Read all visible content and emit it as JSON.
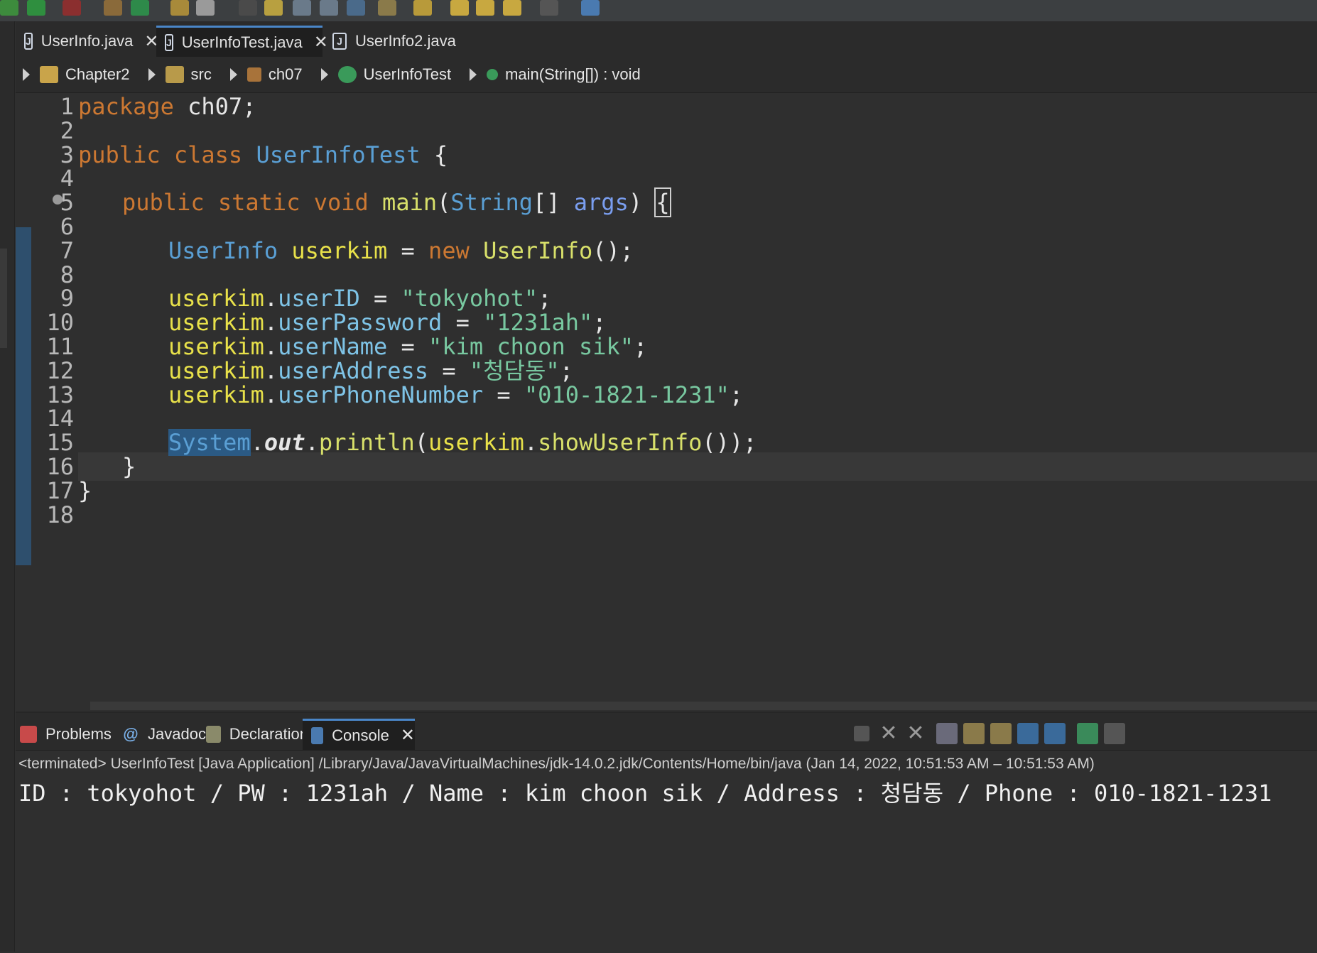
{
  "editor_tabs": [
    {
      "label": "UserInfo.java",
      "closable": true
    },
    {
      "label": "UserInfoTest.java",
      "closable": true,
      "active": true
    },
    {
      "label": "UserInfo2.java",
      "closable": false
    }
  ],
  "breadcrumb": [
    {
      "label": "Chapter2",
      "icon": "project-folder-icon"
    },
    {
      "label": "src",
      "icon": "source-folder-icon"
    },
    {
      "label": "ch07",
      "icon": "package-icon"
    },
    {
      "label": "UserInfoTest",
      "icon": "class-icon"
    },
    {
      "label": "main(String[]) : void",
      "icon": "method-icon"
    }
  ],
  "code": {
    "line_numbers": [
      "1",
      "2",
      "3",
      "4",
      "5",
      "6",
      "7",
      "8",
      "9",
      "10",
      "11",
      "12",
      "13",
      "14",
      "15",
      "16",
      "17",
      "18"
    ],
    "l1_kw": "package",
    "l1_rest": " ch07;",
    "l3_kw": "public class",
    "l3_cls": "UserInfoTest",
    "l3_rest": " {",
    "l5_kw": "public static void",
    "l5_mth": "main",
    "l5_open": "(",
    "l5_type": "String",
    "l5_arr": "[] ",
    "l5_par": "args",
    "l5_close": ") ",
    "l5_brace": "{",
    "l7_type": "UserInfo",
    "l7_var": "userkim",
    "l7_eq": " = ",
    "l7_kw": "new",
    "l7_ctor": "UserInfo",
    "l7_rest": "();",
    "assignments": [
      {
        "obj": "userkim",
        "field": "userID",
        "value": "\"tokyohot\""
      },
      {
        "obj": "userkim",
        "field": "userPassword",
        "value": "\"1231ah\""
      },
      {
        "obj": "userkim",
        "field": "userName",
        "value": "\"kim choon sik\""
      },
      {
        "obj": "userkim",
        "field": "userAddress",
        "value": "\"청담동\""
      },
      {
        "obj": "userkim",
        "field": "userPhoneNumber",
        "value": "\"010-1821-1231\""
      }
    ],
    "l15_sys": "System",
    "l15_out": "out",
    "l15_println": "println",
    "l15_obj": "userkim",
    "l15_mth": "showUserInfo",
    "l15_tail": "());",
    "l16": "}",
    "l17": "}"
  },
  "bottom_tabs": [
    {
      "label": "Problems",
      "icon": "problems-icon"
    },
    {
      "label": "Javadoc",
      "icon": "javadoc-icon"
    },
    {
      "label": "Declaration",
      "icon": "declaration-icon"
    },
    {
      "label": "Console",
      "icon": "console-icon",
      "active": true,
      "closable": true
    }
  ],
  "console": {
    "status": "<terminated> UserInfoTest [Java Application] /Library/Java/JavaVirtualMachines/jdk-14.0.2.jdk/Contents/Home/bin/java  (Jan 14, 2022, 10:51:53 AM – 10:51:53 AM)",
    "output": "ID : tokyohot / PW : 1231ah / Name : kim choon sik / Address : 청담동 / Phone : 010-1821-1231"
  },
  "colors": {
    "keyword": "#cc7832",
    "type": "#5a9fd4",
    "variable": "#e8e14a",
    "string": "#78c8a0",
    "active_tab_accent": "#4a86c8"
  }
}
